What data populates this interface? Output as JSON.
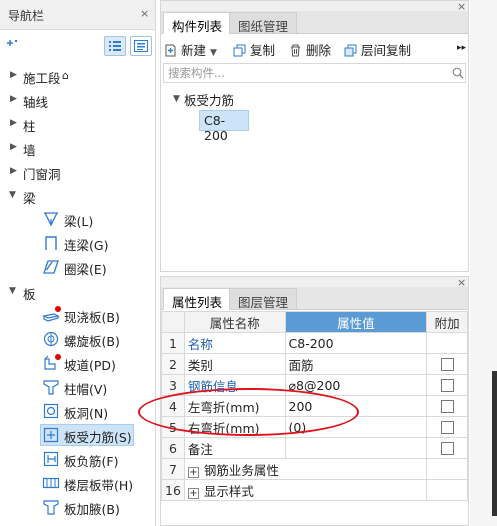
{
  "nav": {
    "title": "导航栏",
    "close": "×",
    "tree": [
      {
        "label": "施工段",
        "extra": "⌂"
      },
      {
        "label": "轴线"
      },
      {
        "label": "柱"
      },
      {
        "label": "墙"
      },
      {
        "label": "门窗洞"
      },
      {
        "label": "梁"
      },
      {
        "label": "板"
      }
    ],
    "beam_items": [
      {
        "label": "梁(L)",
        "icon": "beam-icon"
      },
      {
        "label": "连梁(G)",
        "icon": "coupling-beam-icon"
      },
      {
        "label": "圈梁(E)",
        "icon": "ring-beam-icon"
      }
    ],
    "slab_items": [
      {
        "label": "现浇板(B)",
        "icon": "cast-slab-icon"
      },
      {
        "label": "螺旋板(B)",
        "icon": "spiral-slab-icon"
      },
      {
        "label": "坡道(PD)",
        "icon": "ramp-icon"
      },
      {
        "label": "柱帽(V)",
        "icon": "column-cap-icon"
      },
      {
        "label": "板洞(N)",
        "icon": "slab-hole-icon"
      },
      {
        "label": "板受力筋(S)",
        "icon": "slab-rebar-icon"
      },
      {
        "label": "板负筋(F)",
        "icon": "negative-rebar-icon"
      },
      {
        "label": "楼层板带(H)",
        "icon": "floor-strip-icon"
      },
      {
        "label": "板加腋(B)",
        "icon": "slab-haunch-icon"
      }
    ]
  },
  "component_panel": {
    "tabs": [
      "构件列表",
      "图纸管理"
    ],
    "toolbar": {
      "new": "新建",
      "copy": "复制",
      "delete": "删除",
      "layer_copy": "层间复制",
      "more": "▸▸"
    },
    "search_placeholder": "搜索构件...",
    "tree_root": "板受力筋",
    "tree_child": "C8-200"
  },
  "properties_panel": {
    "tabs": [
      "属性列表",
      "图层管理"
    ],
    "headers": {
      "name": "属性名称",
      "value": "属性值",
      "extra": "附加"
    },
    "rows": [
      {
        "num": "1",
        "name": "名称",
        "value": "C8-200"
      },
      {
        "num": "2",
        "name": "类别",
        "value": "面筋"
      },
      {
        "num": "3",
        "name": "钢筋信息",
        "value": "⌀8@200"
      },
      {
        "num": "4",
        "name": "左弯折(mm)",
        "value": "200"
      },
      {
        "num": "5",
        "name": "右弯折(mm)",
        "value": "(0)"
      },
      {
        "num": "6",
        "name": "备注",
        "value": ""
      },
      {
        "num": "7",
        "name": "钢筋业务属性",
        "value": ""
      },
      {
        "num": "16",
        "name": "显示样式",
        "value": ""
      }
    ]
  },
  "colors": {
    "accent": "#5b9bd5",
    "selection": "#cde3f7",
    "annotation": "#e0131b"
  }
}
